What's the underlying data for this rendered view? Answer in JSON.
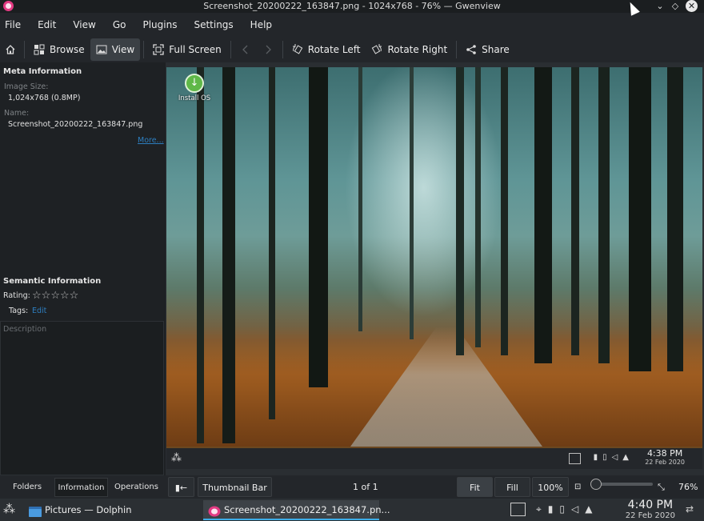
{
  "window": {
    "title": "Screenshot_20200222_163847.png - 1024x768 - 76% — Gwenview",
    "icon": "gwenview-app-icon",
    "controls": [
      "minimize-icon",
      "maximize-icon",
      "close-icon"
    ]
  },
  "menubar": {
    "items": [
      "File",
      "Edit",
      "View",
      "Go",
      "Plugins",
      "Settings",
      "Help"
    ]
  },
  "toolbar": {
    "home_icon": "home-icon",
    "browse": "Browse",
    "view": "View",
    "full_screen": "Full Screen",
    "rotate_left": "Rotate Left",
    "rotate_right": "Rotate Right",
    "share": "Share"
  },
  "sidebar": {
    "meta_heading": "Meta Information",
    "image_size_label": "Image Size:",
    "image_size_value": "1,024x768 (0.8MP)",
    "name_label": "Name:",
    "name_value": "Screenshot_20200222_163847.png",
    "more_link": "More...",
    "semantic_heading": "Semantic Information",
    "rating_label": "Rating:",
    "rating": 0,
    "rating_max": 5,
    "tags_label": "Tags:",
    "tags_link": "Edit",
    "description_placeholder": "Description"
  },
  "image": {
    "desktop_icon_label": "Install OS",
    "panel_time": "4:38 PM",
    "panel_date": "22 Feb 2020"
  },
  "statusbar": {
    "tabs": [
      "Folders",
      "Information",
      "Operations"
    ],
    "active_tab": "Information",
    "thumbnail_bar": "Thumbnail Bar",
    "page_count": "1 of 1",
    "fit": "Fit",
    "fill": "Fill",
    "zoom_100": "100%",
    "zoom_value": "76%"
  },
  "taskbar": {
    "tasks": [
      {
        "label": "Pictures — Dolphin",
        "icon": "folder-icon"
      },
      {
        "label": "Screenshot_20200222_163847.pn...",
        "icon": "gwenview-icon"
      }
    ],
    "time": "4:40 PM",
    "date": "22 Feb 2020"
  },
  "colors": {
    "accent": "#3daee9",
    "link": "#2d7ebf",
    "app_icon": "#e33b83"
  }
}
